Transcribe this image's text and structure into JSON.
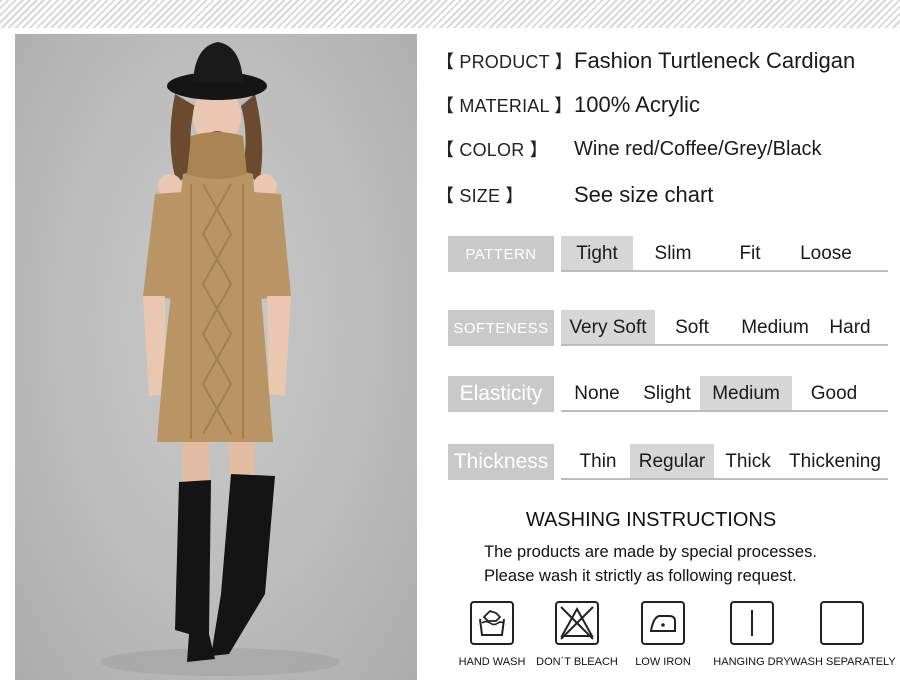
{
  "product": {
    "product_label": "【 PRODUCT 】",
    "product_value": "Fashion Turtleneck Cardigan",
    "material_label": "【 MATERIAL 】",
    "material_value": "100% Acrylic",
    "color_label": "【 COLOR 】",
    "color_value": "Wine red/Coffee/Grey/Black",
    "size_label": "【 SIZE 】",
    "size_value": "See size chart"
  },
  "attributes": {
    "pattern": {
      "label": "PATTERN",
      "options": [
        "Tight",
        "Slim",
        "Fit",
        "Loose"
      ],
      "selected": "Tight"
    },
    "softeness": {
      "label": "SOFTENESS",
      "options": [
        "Very Soft",
        "Soft",
        "Medium",
        "Hard"
      ],
      "selected": "Very Soft"
    },
    "elasticity": {
      "label": "Elasticity",
      "options": [
        "None",
        "Slight",
        "Medium",
        "Good"
      ],
      "selected": "Medium"
    },
    "thickness": {
      "label": "Thickness",
      "options": [
        "Thin",
        "Regular",
        "Thick",
        "Thickening"
      ],
      "selected": "Regular"
    }
  },
  "washing": {
    "title": "WASHING INSTRUCTIONS",
    "line1": "The products are made by special processes.",
    "line2": "Please wash it strictly as following request.",
    "icons": [
      {
        "name": "hand-wash-icon",
        "label": "HAND WASH"
      },
      {
        "name": "dont-bleach-icon",
        "label": "DON´T BLEACH"
      },
      {
        "name": "low-iron-icon",
        "label": "LOW IRON"
      },
      {
        "name": "hanging-dry-icon",
        "label": "HANGING DRY"
      },
      {
        "name": "wash-separately-icon",
        "label": "WASH SEPARATELY"
      }
    ]
  },
  "colors": {
    "tag_bg": "#c9c9c9",
    "selected_bg": "#d6d6d6",
    "sweater": "#b99565"
  }
}
